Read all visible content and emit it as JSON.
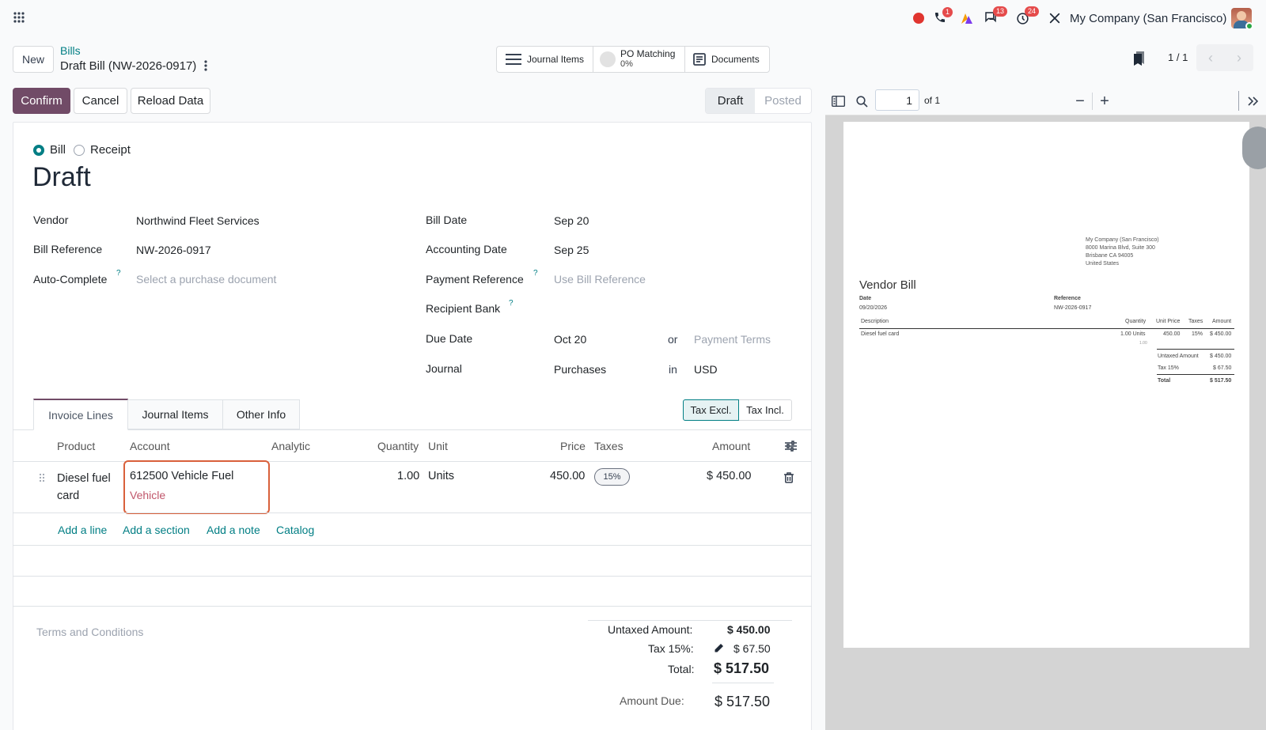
{
  "topbar": {
    "company": "My Company (San Francisco)",
    "badges": {
      "phone": "1",
      "chat": "13",
      "clock": "24"
    }
  },
  "control": {
    "new_label": "New",
    "breadcrumb_parent": "Bills",
    "record_title": "Draft Bill (NW-2026-0917)",
    "smart_buttons": {
      "journal_items": "Journal Items",
      "po_matching": "PO Matching",
      "po_matching_value": "0%",
      "documents": "Documents"
    },
    "pager": "1 / 1"
  },
  "actions": {
    "confirm": "Confirm",
    "cancel": "Cancel",
    "reload": "Reload Data",
    "status": [
      "Draft",
      "Posted"
    ]
  },
  "form": {
    "type_options": [
      "Bill",
      "Receipt"
    ],
    "heading": "Draft",
    "left": {
      "vendor_label": "Vendor",
      "vendor_value": "Northwind Fleet Services",
      "bill_ref_label": "Bill Reference",
      "bill_ref_value": "NW-2026-0917",
      "autocomplete_label": "Auto-Complete",
      "autocomplete_placeholder": "Select a purchase document",
      "help": "?"
    },
    "right": {
      "bill_date_label": "Bill Date",
      "bill_date_value": "Sep 20",
      "accounting_date_label": "Accounting Date",
      "accounting_date_value": "Sep 25",
      "payment_ref_label": "Payment Reference",
      "payment_ref_placeholder": "Use Bill Reference",
      "recipient_bank_label": "Recipient Bank",
      "due_date_label": "Due Date",
      "due_date_value": "Oct 20",
      "or_text": "or",
      "payment_terms_placeholder": "Payment Terms",
      "journal_label": "Journal",
      "journal_value": "Purchases",
      "in_text": "in",
      "currency_value": "USD"
    },
    "tabs": [
      "Invoice Lines",
      "Journal Items",
      "Other Info"
    ],
    "tax_toggle": [
      "Tax Excl.",
      "Tax Incl."
    ],
    "table": {
      "headers": [
        "Product",
        "Account",
        "Analytic",
        "Quantity",
        "Unit",
        "Price",
        "Taxes",
        "Amount"
      ],
      "row": {
        "product_line1": "Diesel fuel",
        "product_line2": "card",
        "account": "612500 Vehicle Fuel",
        "account_sub": "Vehicle",
        "quantity": "1.00",
        "unit": "Units",
        "price": "450.00",
        "tax": "15%",
        "amount": "$ 450.00"
      },
      "add_links": [
        "Add a line",
        "Add a section",
        "Add a note",
        "Catalog"
      ]
    },
    "terms_placeholder": "Terms and Conditions",
    "totals": {
      "untaxed_label": "Untaxed Amount:",
      "untaxed_value": "$ 450.00",
      "tax_label": "Tax 15%:",
      "tax_value": "$ 67.50",
      "total_label": "Total:",
      "total_value": "$ 517.50",
      "due_label": "Amount Due:",
      "due_value": "$ 517.50"
    }
  },
  "pdf_viewer": {
    "page_input": "1",
    "page_of": "of 1",
    "doc": {
      "company_lines": [
        "My Company (San Francisco)",
        "8000 Marina Blvd, Suite 300",
        "Brisbane CA 94005",
        "United States"
      ],
      "title": "Vendor Bill",
      "date_label": "Date",
      "date_value": "09/20/2026",
      "ref_label": "Reference",
      "ref_value": "NW-2026-0917",
      "headers": [
        "Description",
        "Quantity",
        "Unit Price",
        "Taxes",
        "Amount"
      ],
      "line": {
        "desc": "Diesel fuel card",
        "qty": "1.00 Units",
        "qty_sub": "1.00",
        "price": "450.00",
        "tax": "15%",
        "amount": "$ 450.00"
      },
      "untaxed_label": "Untaxed Amount",
      "untaxed_value": "$ 450.00",
      "tax_label": "Tax 15%",
      "tax_value": "$ 67.50",
      "total_label": "Total",
      "total_value": "$ 517.50"
    }
  },
  "colors": {
    "primary": "#714b67",
    "link": "#017e84",
    "highlight": "#d9603b",
    "badge": "#e54b4b"
  }
}
